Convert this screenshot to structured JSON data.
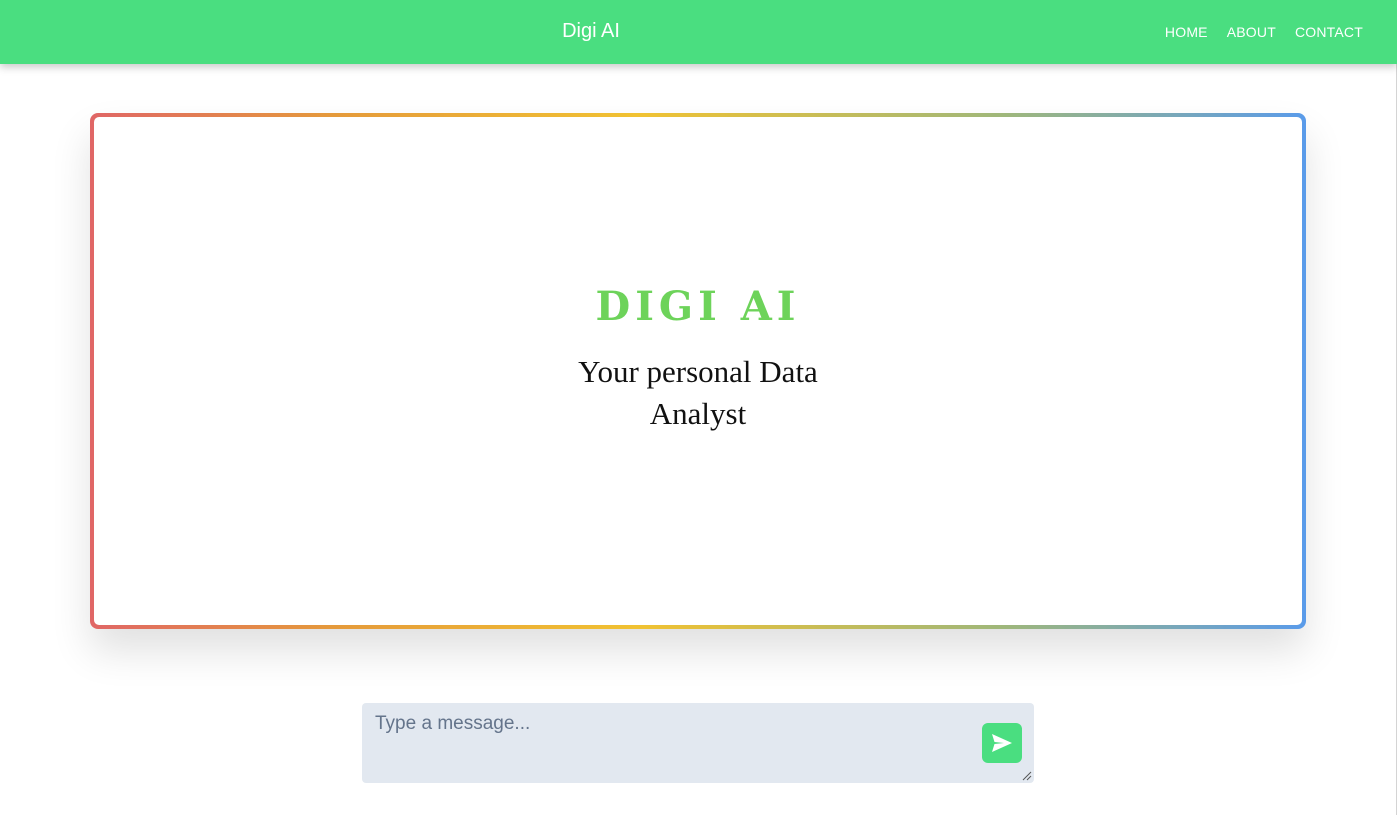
{
  "navbar": {
    "brand": "Digi AI",
    "links": [
      "HOME",
      "ABOUT",
      "CONTACT"
    ]
  },
  "hero": {
    "title": "DIGI AI",
    "subtitle": "Your personal Data Analyst"
  },
  "chat": {
    "placeholder": "Type a message...",
    "value": ""
  },
  "colors": {
    "accent": "#4ade80",
    "title_green": "#6dd35a",
    "input_bg": "#e2e8f0"
  },
  "icons": {
    "send": "send-icon"
  }
}
